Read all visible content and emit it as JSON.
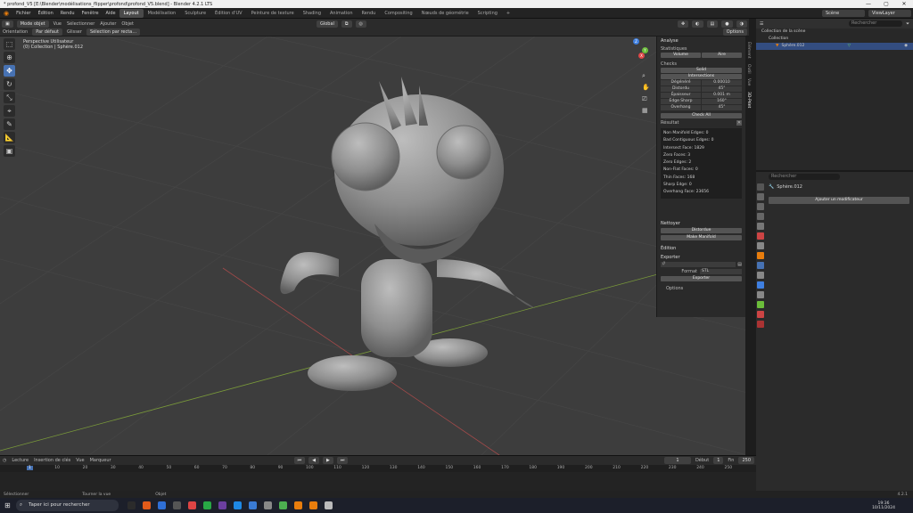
{
  "window": {
    "title": "* profond_V5 [E:\\Blender\\modélisations_flipper\\profond\\profond_V5.blend] - Blender 4.2.1 LTS",
    "controls": [
      "—",
      "▢",
      "✕"
    ]
  },
  "menubar": {
    "items": [
      "Fichier",
      "Édition",
      "Rendu",
      "Fenêtre",
      "Aide"
    ],
    "workspaces": [
      "Layout",
      "Modélisation",
      "Sculpture",
      "Édition d'UV",
      "Peinture de texture",
      "Shading",
      "Animation",
      "Rendu",
      "Compositing",
      "Nœuds de géométrie",
      "Scripting"
    ],
    "active_workspace": "Layout",
    "add_tab": "+",
    "scene": "Scène",
    "view_layer": "ViewLayer"
  },
  "viewport_header": {
    "mode": "Mode objet",
    "menus": [
      "Vue",
      "Sélectionner",
      "Ajouter",
      "Objet"
    ],
    "orientation_label": "Orientation",
    "orientation_value": "Par défaut",
    "drag_label": "Glisser",
    "drag_value": "Sélection par recta…",
    "transform": "Global",
    "options": "Options"
  },
  "viewport": {
    "info_line1": "Perspective Utilisateur",
    "info_line2": "(0) Collection | Sphère.012",
    "axes": {
      "x": "X",
      "y": "Y",
      "z": "Z"
    }
  },
  "npanel": {
    "title": "Analyse",
    "statistics": "Statistiques",
    "volume": "Volume",
    "area": "Aire",
    "checks": "Checks",
    "solid": "Solid",
    "intersections": "Intersections",
    "rows": [
      {
        "label": "Dégénéré",
        "value": "0.00010"
      },
      {
        "label": "Distordu",
        "value": "45°"
      },
      {
        "label": "Épaisseur",
        "value": "0.001 m"
      },
      {
        "label": "Edge Sharp",
        "value": "160°"
      },
      {
        "label": "Overhang",
        "value": "45°"
      }
    ],
    "check_all": "Check All",
    "result_title": "Résultat",
    "results": [
      "Non Manifold Edges: 0",
      "Bad Contiguous Edges: 0",
      "Intersect Face: 1829",
      "Zero Faces: 3",
      "Zero Edges: 2",
      "Non-Flat Faces: 0",
      "Thin Faces: 168",
      "Sharp Edge: 0",
      "Overhang Face: 23656"
    ],
    "clean_title": "Nettoyer",
    "distorted": "Distordue",
    "make_manifold": "Make Manifold",
    "edit_title": "Édition",
    "export_title": "Exporter",
    "export_path": "//",
    "format_label": "Format",
    "format_value": "STL",
    "export_button": "Exporter",
    "options": "Options"
  },
  "side_tabs": [
    "Élément",
    "Outil",
    "Vue",
    "3D-Print"
  ],
  "outliner": {
    "search_placeholder": "Rechercher",
    "scene_collection": "Collection de la scène",
    "collection": "Collection",
    "object": "Sphère.012"
  },
  "properties": {
    "search_placeholder": "Rechercher",
    "object": "Sphère.012",
    "add_modifier": "Ajouter un modificateur"
  },
  "timeline": {
    "menus": [
      "Lecture",
      "Insertion de clés",
      "Vue",
      "Marqueur"
    ],
    "current_frame": "1",
    "start_label": "Début",
    "start": "1",
    "end_label": "Fin",
    "end": "250",
    "ticks": [
      "1",
      "10",
      "20",
      "30",
      "40",
      "50",
      "60",
      "70",
      "80",
      "90",
      "100",
      "110",
      "120",
      "130",
      "140",
      "150",
      "160",
      "170",
      "180",
      "190",
      "200",
      "210",
      "220",
      "230",
      "240",
      "250"
    ]
  },
  "statusbar": {
    "select": "Sélectionner",
    "rotate": "Tourner la vue",
    "object": "Objet",
    "version": "4.2.1"
  },
  "taskbar": {
    "search_placeholder": "Taper ici pour rechercher",
    "time": "19:36",
    "date": "10/11/2024",
    "icon_colors": [
      "#2b2b2b",
      "#e25b1a",
      "#2f6fd6",
      "#555555",
      "#d44",
      "#28a745",
      "#6b3fa0",
      "#1e88e5",
      "#3a7bd5",
      "#888888",
      "#4caf50",
      "#e87d0d",
      "#e87d0d",
      "#bbbbbb"
    ]
  }
}
